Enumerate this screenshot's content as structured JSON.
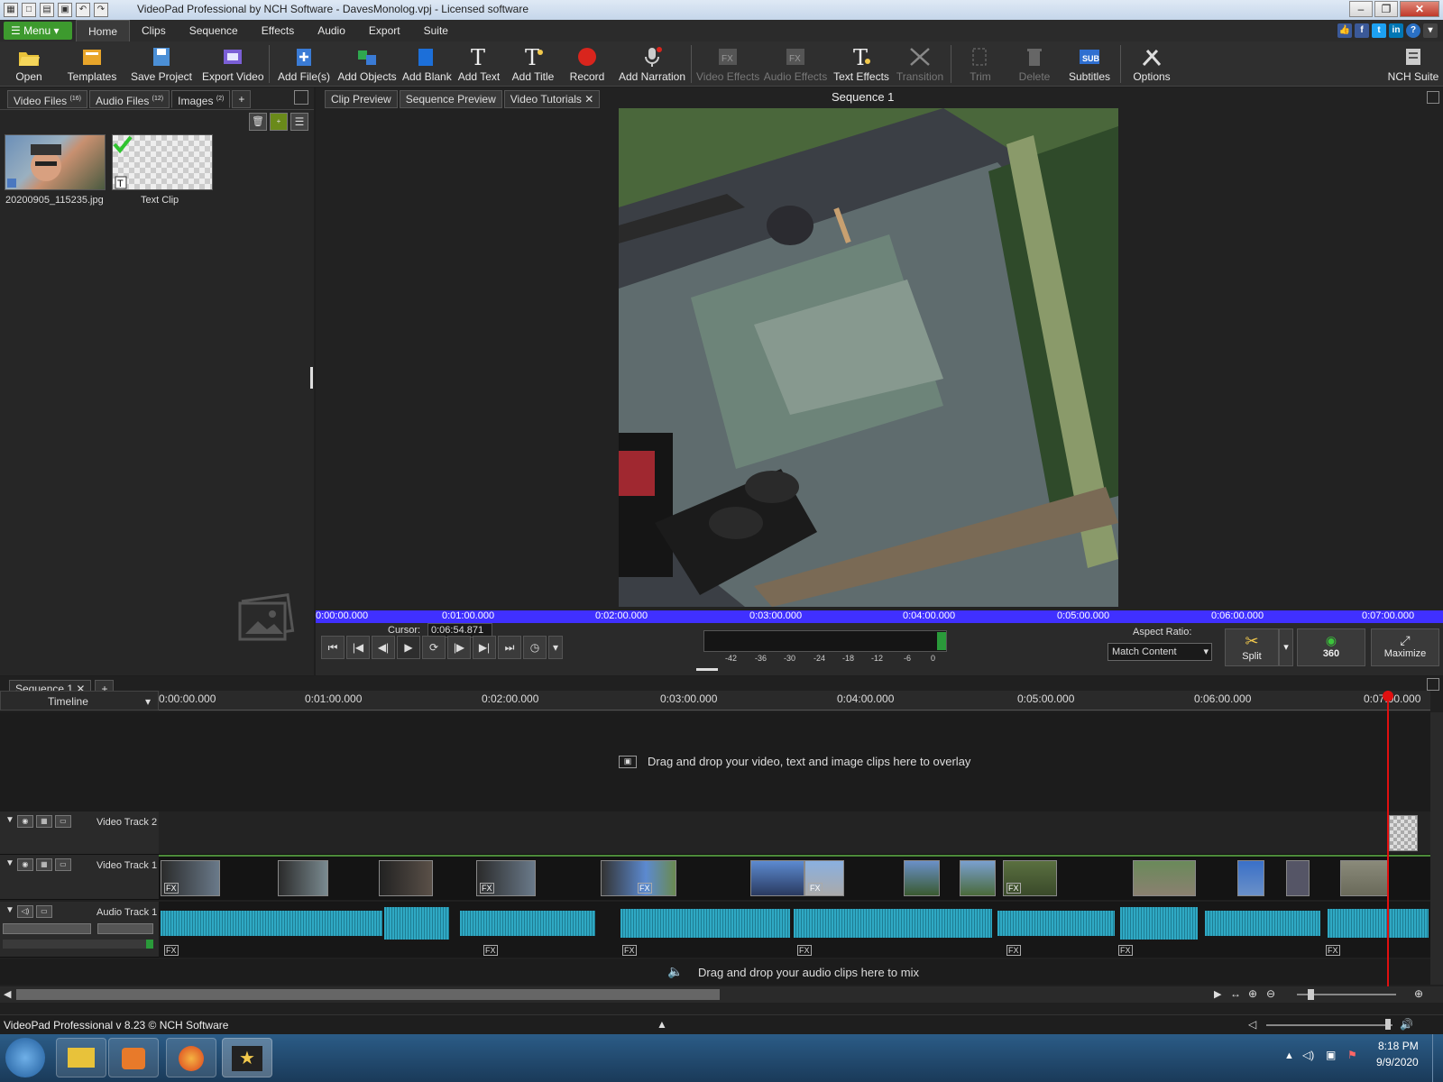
{
  "window": {
    "title": "VideoPad Professional by NCH Software - DavesMonolog.vpj - Licensed software"
  },
  "menu": {
    "menu_label": "Menu",
    "tabs": [
      "Home",
      "Clips",
      "Sequence",
      "Effects",
      "Audio",
      "Export",
      "Suite"
    ]
  },
  "toolbar": {
    "open": "Open",
    "templates": "Templates",
    "save_project": "Save Project",
    "export_video": "Export Video",
    "add_files": "Add File(s)",
    "add_objects": "Add Objects",
    "add_blank": "Add Blank",
    "add_text": "Add Text",
    "add_title": "Add Title",
    "record": "Record",
    "add_narration": "Add Narration",
    "video_effects": "Video Effects",
    "audio_effects": "Audio Effects",
    "text_effects": "Text Effects",
    "transition": "Transition",
    "trim": "Trim",
    "delete": "Delete",
    "subtitles": "Subtitles",
    "options": "Options",
    "nch_suite": "NCH Suite"
  },
  "left_panel": {
    "tabs": [
      {
        "label": "Video Files",
        "count": "(16)"
      },
      {
        "label": "Audio Files",
        "count": "(12)"
      },
      {
        "label": "Images",
        "count": "(2)"
      }
    ],
    "add_tab": "+",
    "items": [
      {
        "label": "20200905_115235.jpg"
      },
      {
        "label": "Text Clip"
      }
    ]
  },
  "preview": {
    "tabs": [
      "Clip Preview",
      "Sequence Preview",
      "Video Tutorials"
    ],
    "title": "Sequence 1",
    "ruler_ticks": [
      "0:00:00.000",
      "0:01:00.000",
      "0:02:00.000",
      "0:03:00.000",
      "0:04:00.000",
      "0:05:00.000",
      "0:06:00.000",
      "0:07:00.000"
    ],
    "cursor_label": "Cursor:",
    "cursor_value": "0:06:54.871",
    "meter_labels": [
      "-42",
      "-36",
      "-30",
      "-24",
      "-18",
      "-12",
      "-6",
      "0"
    ],
    "aspect_label": "Aspect Ratio:",
    "aspect_value": "Match Content",
    "split": "Split",
    "btn_360": "360",
    "maximize": "Maximize"
  },
  "timeline": {
    "sequence_tab": "Sequence 1",
    "add_tab": "+",
    "mode": "Timeline",
    "ruler_ticks": [
      "0:00:00.000",
      "0:01:00.000",
      "0:02:00.000",
      "0:03:00.000",
      "0:04:00.000",
      "0:05:00.000",
      "0:06:00.000",
      "0:07:00.000"
    ],
    "overlay_hint": "Drag and drop your video, text and image clips here to overlay",
    "video_track_2": "Video Track 2",
    "video_track_1": "Video Track 1",
    "audio_track_1": "Audio Track 1",
    "audio_hint": "Drag and drop your audio clips here to mix",
    "fx": "FX"
  },
  "status": {
    "version": "VideoPad Professional v 8.23 © NCH Software"
  },
  "taskbar": {
    "time": "8:18 PM",
    "date": "9/9/2020"
  },
  "colors": {
    "accent_green": "#3d9a2e",
    "ruler_blue": "#4030ff",
    "waveform": "#2fa9c4",
    "playhead": "#e01010"
  }
}
